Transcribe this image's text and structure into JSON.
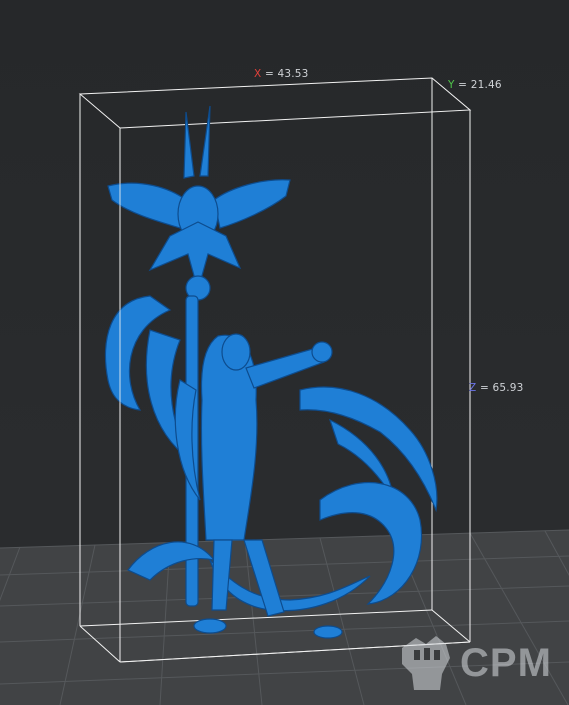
{
  "dimensions": {
    "x": {
      "axis": "X",
      "value": "= 43.53",
      "color": "#e0413a"
    },
    "y": {
      "axis": "Y",
      "value": "= 21.46",
      "color": "#4fc34a"
    },
    "z": {
      "axis": "Z",
      "value": "= 65.93",
      "color": "#6b74e8"
    }
  },
  "model": {
    "color": "#1f7fd6",
    "icon": "miniature-model"
  },
  "watermark": {
    "text": "CPM",
    "icon": "fist-logo-icon"
  }
}
